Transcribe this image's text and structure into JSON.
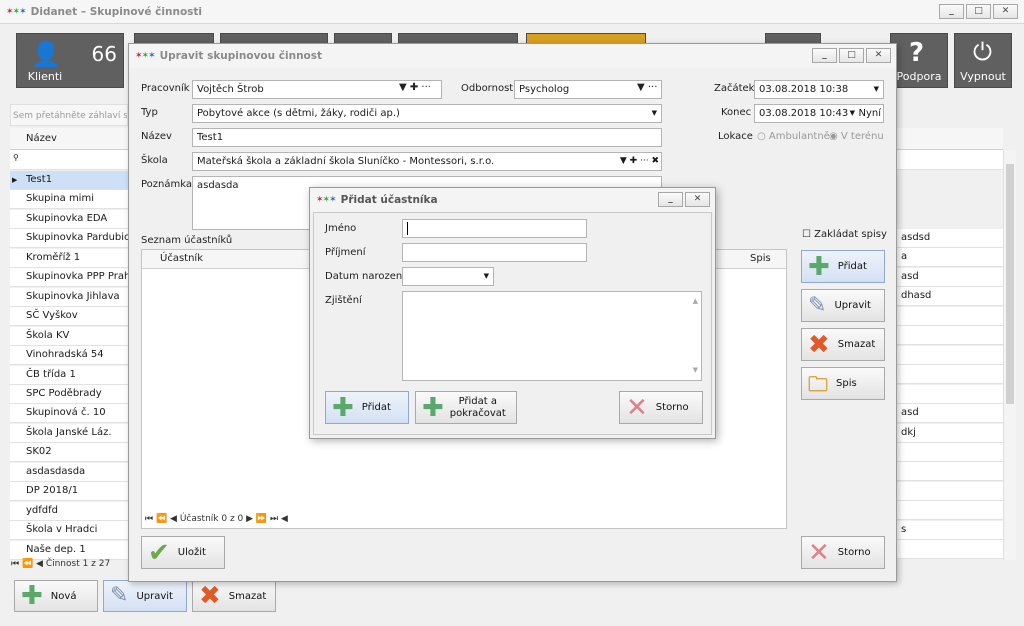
{
  "app": {
    "title": "Didanet – Skupinové činnosti"
  },
  "toolbar": {
    "count": "66",
    "klienti": "Klienti",
    "podpora": "Podpora",
    "vypnout": "Vypnout"
  },
  "main": {
    "group_hint": "Sem přetáhněte záhlaví s",
    "col_nazev": "Název",
    "rows": [
      "Test1",
      "Skupina mimi",
      "Skupinovka EDA",
      "Skupinovka Pardubice",
      "Kroměříž 1",
      "Skupinovka PPP Praha",
      "Skupinovka Jihlava",
      "SČ Vyškov",
      "Škola KV",
      "Vinohradská 54",
      "ČB třída 1",
      "SPC Poděbrady",
      "Skupinová č. 10",
      "Škola Janské Láz.",
      "SK02",
      "asdasdasda",
      "DP 2018/1",
      "ydfdfd",
      "Škola v Hradci",
      "Naše dep. 1"
    ],
    "right_cells": [
      "asdsd",
      "a",
      "asd",
      "dhasd",
      "",
      "",
      "",
      "",
      "",
      "asd",
      "dkj",
      "",
      "",
      "",
      "",
      "s",
      ""
    ],
    "nav": "Činnost 1 z 27",
    "btn_nova": "Nová",
    "btn_upravit": "Upravit",
    "btn_smazat": "Smazat"
  },
  "dialog": {
    "title": "Upravit skupinovou činnost",
    "pracovnik_label": "Pracovník",
    "pracovnik": "Vojtěch Štrob",
    "odbornost_label": "Odbornost",
    "odbornost": "Psycholog",
    "zacatek_label": "Začátek",
    "zacatek": "03.08.2018 10:38",
    "typ_label": "Typ",
    "typ": "Pobytové akce (s dětmi, žáky, rodiči ap.)",
    "konec_label": "Konec",
    "konec": "03.08.2018 10:43",
    "nyni": "Nyní",
    "nazev_label": "Název",
    "nazev": "Test1",
    "lokace_label": "Lokace",
    "ambulantne": "Ambulantně",
    "v_terenu": "V terénu",
    "skola_label": "Škola",
    "skola": "Mateřská škola a základní škola Sluníčko - Montessori, s.r.o.",
    "poznamka_label": "Poznámka",
    "poznamka": "asdasda",
    "seznam_label": "Seznam účastníků",
    "col_ucastnik": "Účastník",
    "col_spis": "Spis",
    "nav": "Účastník 0 z 0",
    "zakladat_spisy": "Zakládat spisy",
    "btn_pridat": "Přidat",
    "btn_upravit": "Upravit",
    "btn_smazat": "Smazat",
    "btn_spis": "Spis",
    "btn_ulozit": "Uložit",
    "btn_storno": "Storno"
  },
  "subdialog": {
    "title": "Přidat účastníka",
    "jmeno_label": "Jméno",
    "prijmeni_label": "Příjmení",
    "datum_label": "Datum narození",
    "zjisteni_label": "Zjištění",
    "jmeno": "",
    "prijmeni": "",
    "datum": "",
    "zjisteni": "",
    "btn_pridat": "Přidat",
    "btn_pridat_pokr": "Přidat a pokračovat",
    "btn_storno": "Storno"
  }
}
